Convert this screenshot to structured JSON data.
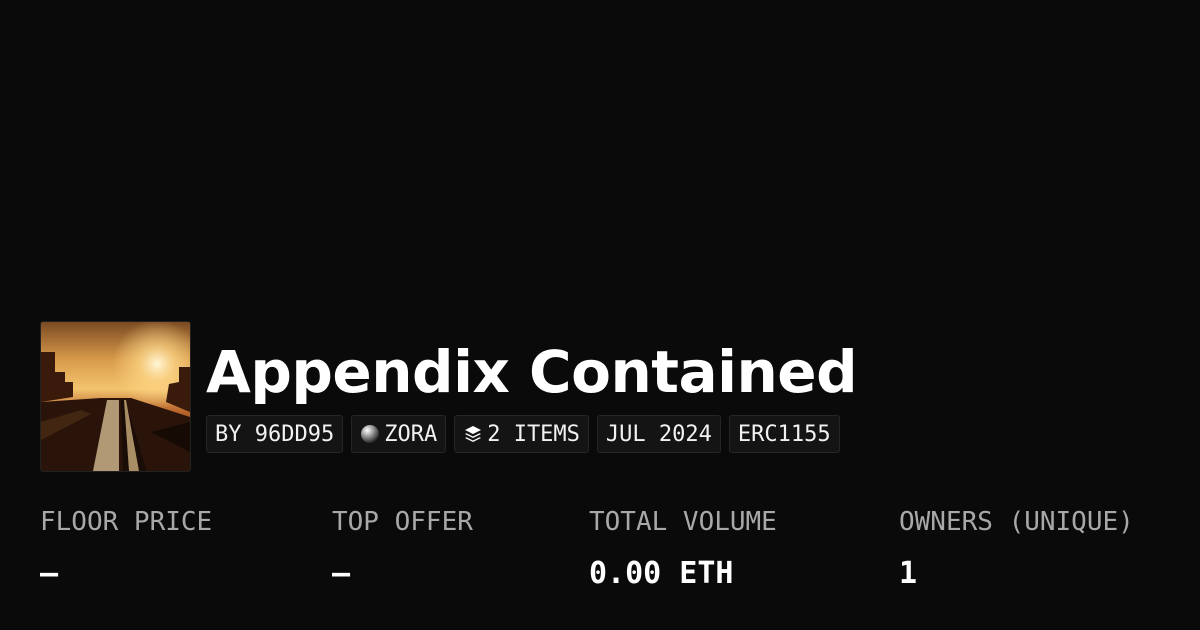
{
  "collection": {
    "title": "Appendix Contained",
    "badges": {
      "creator": "BY 96DD95",
      "chain": "ZORA",
      "items": "2 ITEMS",
      "date": "JUL 2024",
      "standard": "ERC1155"
    },
    "icons": {
      "chain": "zora-orb-icon",
      "items": "layers-icon"
    }
  },
  "stats": {
    "floor_price": {
      "label": "FLOOR PRICE",
      "value": "–"
    },
    "top_offer": {
      "label": "TOP OFFER",
      "value": "–"
    },
    "total_volume": {
      "label": "TOTAL VOLUME",
      "value": "0.00 ETH"
    },
    "owners": {
      "label": "OWNERS (UNIQUE)",
      "value": "1"
    }
  },
  "colors": {
    "background": "#0a0a0a",
    "badge_background": "#141414",
    "label": "#a8a8a8",
    "text": "#ffffff"
  }
}
